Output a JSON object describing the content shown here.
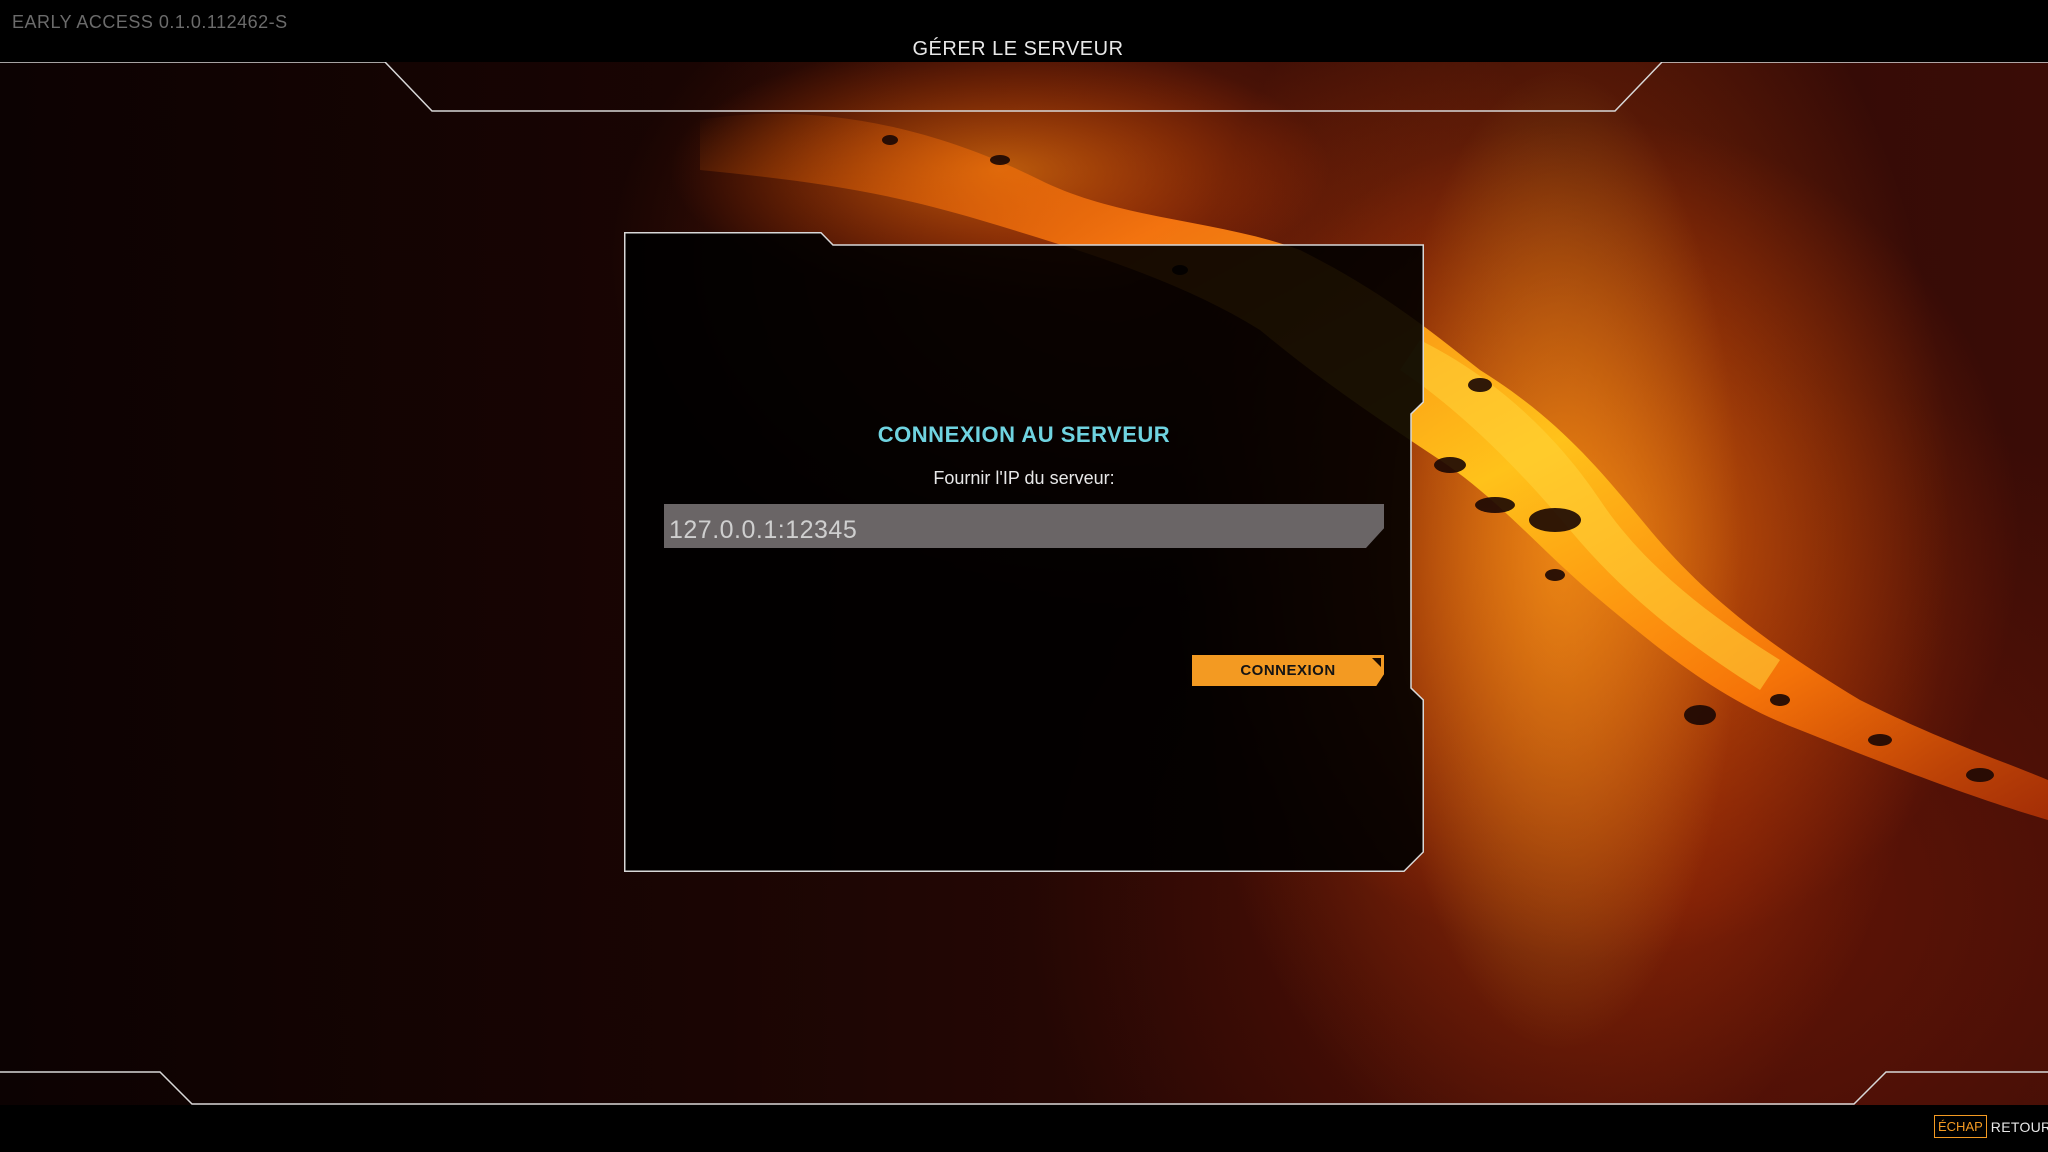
{
  "header": {
    "version": "EARLY ACCESS 0.1.0.112462-S",
    "title": "GÉRER LE SERVEUR"
  },
  "dialog": {
    "title": "CONNEXION AU SERVEUR",
    "prompt": "Fournir l'IP du serveur:",
    "ip_value": "127.0.0.1:12345",
    "connect_label": "CONNEXION"
  },
  "footer": {
    "back_key": "ÉCHAP",
    "back_label": "RETOUR"
  },
  "colors": {
    "accent": "#f39a22",
    "title_cyan": "#6fd3e0",
    "input_bg": "#6a6566"
  }
}
